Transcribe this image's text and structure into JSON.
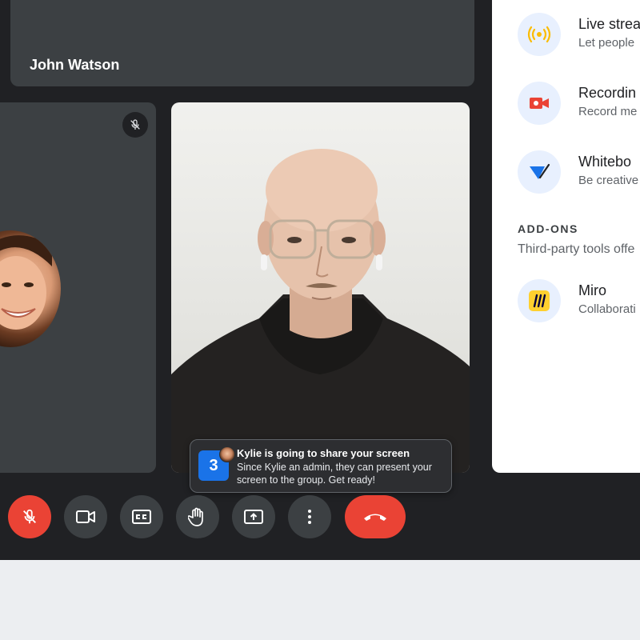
{
  "participants": {
    "top_name": "John Watson"
  },
  "toast": {
    "count": "3",
    "title": "Kylie is going to share your screen",
    "body": "Since Kylie an admin, they can present your screen to the group. Get ready!"
  },
  "controls": {
    "mic": "mic-off-icon",
    "camera": "videocam-icon",
    "captions": "closed-captions-icon",
    "hand": "raise-hand-icon",
    "present": "present-screen-icon",
    "more": "more-vert-icon",
    "hangup": "call-end-icon"
  },
  "panel": {
    "items": [
      {
        "title": "Live strea",
        "subtitle": "Let people",
        "icon": "live-stream-icon"
      },
      {
        "title": "Recordin",
        "subtitle": "Record me",
        "icon": "recording-icon"
      },
      {
        "title": "Whitebo",
        "subtitle": "Be creative",
        "icon": "whiteboard-icon"
      }
    ],
    "addons_heading": "ADD-ONS",
    "addons_subtitle": "Third-party tools offe",
    "addons": [
      {
        "title": "Miro",
        "subtitle": "Collaborati",
        "icon": "miro-icon"
      }
    ]
  },
  "colors": {
    "background": "#202124",
    "tile": "#3c4043",
    "danger": "#ea4335",
    "accent": "#1a73e8",
    "live_yellow": "#fbbc04"
  }
}
